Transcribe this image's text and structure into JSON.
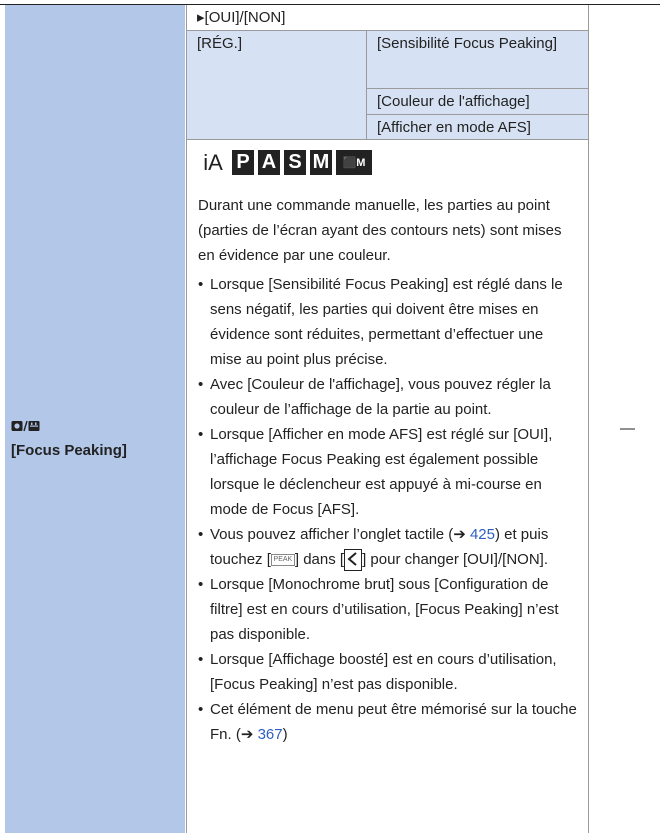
{
  "menu": {
    "icon": "photo-video-icon",
    "title": "[Focus Peaking]"
  },
  "settings": {
    "on_off": "▸[OUI]/[NON]",
    "reg": "[RÉG.]",
    "sub_items": [
      "[Sensibilité Focus Peaking]",
      "[Couleur de l'affichage]",
      "[Afficher en mode AFS]"
    ]
  },
  "modes": [
    "iA",
    "P",
    "A",
    "S",
    "M",
    "⬛M"
  ],
  "description": "Durant une commande manuelle, les parties au point (parties de l’écran ayant des contours nets) sont mises en évidence par une couleur.",
  "bullets": [
    "Lorsque [Sensibilité Focus Peaking] est réglé dans le sens négatif, les parties qui doivent être mises en évidence sont réduites, permettant d’effectuer une mise au point plus précise.",
    "Avec [Couleur de l'affichage], vous pouvez régler la couleur de l’affichage de la partie au point.",
    "Lorsque [Afficher en mode AFS] est réglé sur [OUI], l’affichage Focus Peaking est également possible lorsque le déclencheur est appuyé à mi-course en mode de Focus [AFS].",
    {
      "before": "Vous pouvez afficher l’onglet tactile (➔ ",
      "link": "425",
      "middle": ") et puis touchez [",
      "icon": "PEAK",
      "middle2": "] dans [",
      "after": "] pour changer [OUI]/[NON]."
    },
    "Lorsque [Monochrome brut] sous [Configuration de filtre] est en cours d’utilisation, [Focus Peaking] n’est pas disponible.",
    "Lorsque [Affichage boosté] est en cours d’utilisation, [Focus Peaking] n’est pas disponible.",
    {
      "before": "Cet élément de menu peut être mémorisé sur la touche Fn. (➔ ",
      "link": "367",
      "after": ")"
    }
  ],
  "right_col": "—"
}
